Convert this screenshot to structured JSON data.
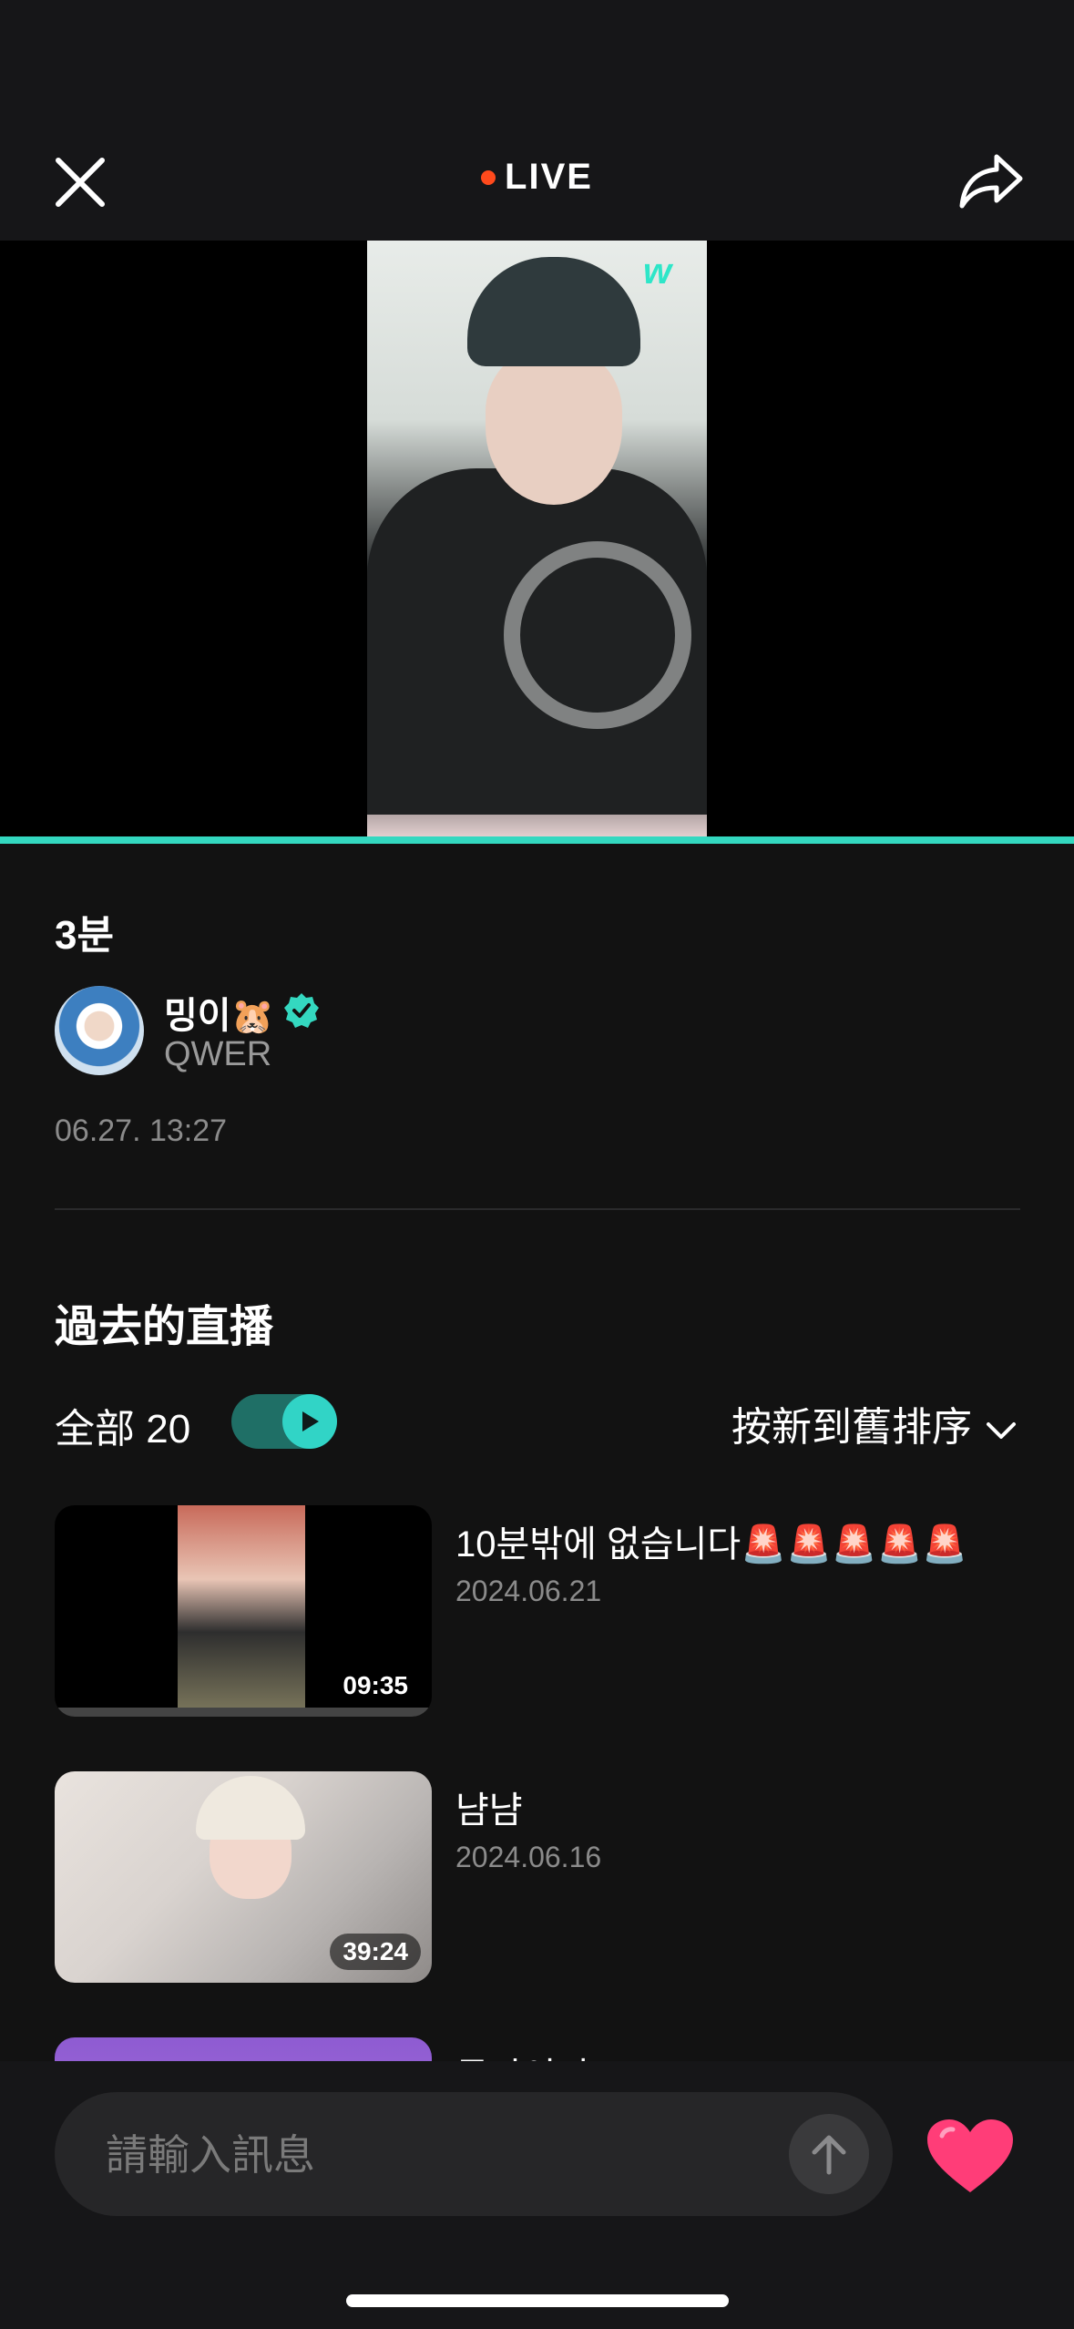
{
  "header": {
    "live_label": "LIVE"
  },
  "stream": {
    "duration": "3분",
    "host_name": "밍이",
    "host_emoji": "🐹",
    "host_group": "QWER",
    "datetime": "06.27. 13:27"
  },
  "past": {
    "section_title": "過去的直播",
    "filter_all": "全部 20",
    "sort_label": "按新到舊排序",
    "items": [
      {
        "title": "10분밖에 없습니다🚨🚨🚨🚨🚨",
        "date": "2024.06.21",
        "duration": "09:35"
      },
      {
        "title": "냠냠",
        "date": "2024.06.16",
        "duration": "39:24"
      },
      {
        "title": "동까이되"
      }
    ]
  },
  "chat": {
    "placeholder": "請輸入訊息"
  },
  "colors": {
    "accent": "#34d8c0",
    "live": "#ff4a1c",
    "heart": "#ff3d78"
  }
}
